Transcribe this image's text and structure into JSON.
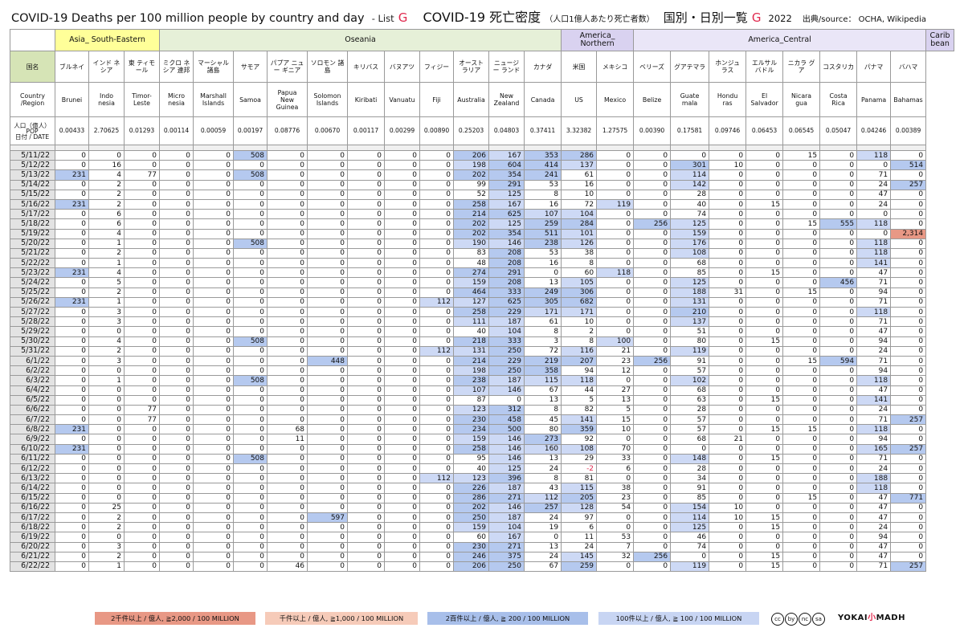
{
  "title": {
    "en": "COVID-19 Deaths per 100 million people by country and day",
    "list": "- List",
    "list_letter": "G",
    "jp_main": "COVID-19 死亡密度",
    "jp_note": "（人口1億人あたり死亡者数）",
    "jp_sub": "国別・日別一覧",
    "jp_letter": "G",
    "year": "2022",
    "source": "出典/source： OCHA, Wikipedia"
  },
  "labels": {
    "jp_row": "国名",
    "en_row": "Country /Region",
    "pop_row_a": "人口（億人）",
    "pop_row_b": "POP",
    "pop_row_c": "日付 / DATE"
  },
  "regions": [
    {
      "name": "Asia_ South-Eastern",
      "span": 3,
      "color": "#ffff99"
    },
    {
      "name": "Oseania",
      "span": 11,
      "color": "#e6f0d8"
    },
    {
      "name": "America_ Northern",
      "span": 2,
      "color": "#d9d2f0"
    },
    {
      "name": "America_Central",
      "span": 8,
      "color": "#eae6f7"
    },
    {
      "name": "Carib bean",
      "span": 1,
      "color": "#d9d2f0"
    }
  ],
  "countries": [
    {
      "jp": "ブルネイ",
      "en": "Brunei",
      "pop": "0.00433"
    },
    {
      "jp": "インド ネシア",
      "en": "Indo nesia",
      "pop": "2.70625"
    },
    {
      "jp": "東 ティモール",
      "en": "Timor- Leste",
      "pop": "0.01293"
    },
    {
      "jp": "ミクロ ネシア 連邦",
      "en": "Micro nesia",
      "pop": "0.00114"
    },
    {
      "jp": "マーシャル 諸島",
      "en": "Marshall Islands",
      "pop": "0.00059"
    },
    {
      "jp": "サモア",
      "en": "Samoa",
      "pop": "0.00197"
    },
    {
      "jp": "パプア ニュー ギニア",
      "en": "Papua New Guinea",
      "pop": "0.08776"
    },
    {
      "jp": "ソロモン 諸島",
      "en": "Solomon Islands",
      "pop": "0.00670"
    },
    {
      "jp": "キリバス",
      "en": "Kiribati",
      "pop": "0.00117"
    },
    {
      "jp": "バヌアツ",
      "en": "Vanuatu",
      "pop": "0.00299"
    },
    {
      "jp": "フィジー",
      "en": "Fiji",
      "pop": "0.00890"
    },
    {
      "jp": "オースト ラリア",
      "en": "Australia",
      "pop": "0.25203"
    },
    {
      "jp": "ニュージー ランド",
      "en": "New Zealand",
      "pop": "0.04803"
    },
    {
      "jp": "カナダ",
      "en": "Canada",
      "pop": "0.37411"
    },
    {
      "jp": "米国",
      "en": "US",
      "pop": "3.32382"
    },
    {
      "jp": "メキシコ",
      "en": "Mexico",
      "pop": "1.27575"
    },
    {
      "jp": "ベリーズ",
      "en": "Belize",
      "pop": "0.00390"
    },
    {
      "jp": "グアテマラ",
      "en": "Guate mala",
      "pop": "0.17581"
    },
    {
      "jp": "ホンジュ ラス",
      "en": "Hondu ras",
      "pop": "0.09746"
    },
    {
      "jp": "エルサル バドル",
      "en": "El Salvador",
      "pop": "0.06453"
    },
    {
      "jp": "ニカラ グア",
      "en": "Nicara gua",
      "pop": "0.06545"
    },
    {
      "jp": "コスタリカ",
      "en": "Costa Rica",
      "pop": "0.05047"
    },
    {
      "jp": "パナマ",
      "en": "Panama",
      "pop": "0.04246"
    },
    {
      "jp": "バハマ",
      "en": "Bahamas",
      "pop": "0.00389"
    }
  ],
  "rows": [
    {
      "date": "5/11/22",
      "v": [
        0,
        0,
        0,
        0,
        0,
        508,
        0,
        0,
        0,
        0,
        0,
        206,
        167,
        353,
        286,
        0,
        0,
        0,
        0,
        0,
        15,
        0,
        118,
        0
      ]
    },
    {
      "date": "5/12/22",
      "v": [
        0,
        16,
        0,
        0,
        0,
        0,
        0,
        0,
        0,
        0,
        0,
        198,
        604,
        414,
        137,
        0,
        0,
        301,
        10,
        0,
        0,
        0,
        0,
        514
      ]
    },
    {
      "date": "5/13/22",
      "v": [
        231,
        4,
        77,
        0,
        0,
        508,
        0,
        0,
        0,
        0,
        0,
        202,
        354,
        241,
        61,
        0,
        0,
        114,
        0,
        0,
        0,
        0,
        71,
        0
      ]
    },
    {
      "date": "5/14/22",
      "v": [
        0,
        2,
        0,
        0,
        0,
        0,
        0,
        0,
        0,
        0,
        0,
        99,
        291,
        53,
        16,
        0,
        0,
        142,
        0,
        0,
        0,
        0,
        24,
        257
      ]
    },
    {
      "date": "5/15/22",
      "v": [
        0,
        2,
        0,
        0,
        0,
        0,
        0,
        0,
        0,
        0,
        0,
        52,
        125,
        8,
        10,
        0,
        0,
        28,
        0,
        0,
        0,
        0,
        47,
        0
      ]
    },
    {
      "date": "5/16/22",
      "v": [
        231,
        2,
        0,
        0,
        0,
        0,
        0,
        0,
        0,
        0,
        0,
        258,
        167,
        16,
        72,
        119,
        0,
        40,
        0,
        15,
        0,
        0,
        24,
        0
      ]
    },
    {
      "date": "5/17/22",
      "v": [
        0,
        6,
        0,
        0,
        0,
        0,
        0,
        0,
        0,
        0,
        0,
        214,
        625,
        107,
        104,
        0,
        0,
        74,
        0,
        0,
        0,
        0,
        0,
        0
      ]
    },
    {
      "date": "5/18/22",
      "v": [
        0,
        6,
        0,
        0,
        0,
        0,
        0,
        0,
        0,
        0,
        0,
        202,
        125,
        259,
        284,
        0,
        256,
        125,
        0,
        0,
        15,
        555,
        118,
        0
      ]
    },
    {
      "date": "5/19/22",
      "v": [
        0,
        4,
        0,
        0,
        0,
        0,
        0,
        0,
        0,
        0,
        0,
        202,
        354,
        511,
        101,
        0,
        0,
        159,
        0,
        0,
        0,
        0,
        0,
        "2,314"
      ]
    },
    {
      "date": "5/20/22",
      "v": [
        0,
        1,
        0,
        0,
        0,
        508,
        0,
        0,
        0,
        0,
        0,
        190,
        146,
        238,
        126,
        0,
        0,
        176,
        0,
        0,
        0,
        0,
        118,
        0
      ]
    },
    {
      "date": "5/21/22",
      "v": [
        0,
        2,
        0,
        0,
        0,
        0,
        0,
        0,
        0,
        0,
        0,
        83,
        208,
        53,
        38,
        0,
        0,
        108,
        0,
        0,
        0,
        0,
        118,
        0
      ]
    },
    {
      "date": "5/22/22",
      "v": [
        0,
        1,
        0,
        0,
        0,
        0,
        0,
        0,
        0,
        0,
        0,
        48,
        208,
        16,
        8,
        0,
        0,
        68,
        0,
        0,
        0,
        0,
        141,
        0
      ]
    },
    {
      "date": "5/23/22",
      "v": [
        231,
        4,
        0,
        0,
        0,
        0,
        0,
        0,
        0,
        0,
        0,
        274,
        291,
        0,
        60,
        118,
        0,
        85,
        0,
        15,
        0,
        0,
        47,
        0
      ]
    },
    {
      "date": "5/24/22",
      "v": [
        0,
        5,
        0,
        0,
        0,
        0,
        0,
        0,
        0,
        0,
        0,
        159,
        208,
        13,
        105,
        0,
        0,
        125,
        0,
        0,
        0,
        456,
        71,
        0
      ]
    },
    {
      "date": "5/25/22",
      "v": [
        0,
        2,
        0,
        0,
        0,
        0,
        0,
        0,
        0,
        0,
        0,
        464,
        333,
        249,
        306,
        0,
        0,
        188,
        31,
        0,
        15,
        0,
        94,
        0
      ]
    },
    {
      "date": "5/26/22",
      "v": [
        231,
        1,
        0,
        0,
        0,
        0,
        0,
        0,
        0,
        0,
        112,
        127,
        625,
        305,
        682,
        0,
        0,
        131,
        0,
        0,
        0,
        0,
        71,
        0
      ]
    },
    {
      "date": "5/27/22",
      "v": [
        0,
        3,
        0,
        0,
        0,
        0,
        0,
        0,
        0,
        0,
        0,
        258,
        229,
        171,
        171,
        0,
        0,
        210,
        0,
        0,
        0,
        0,
        118,
        0
      ]
    },
    {
      "date": "5/28/22",
      "v": [
        0,
        3,
        0,
        0,
        0,
        0,
        0,
        0,
        0,
        0,
        0,
        111,
        187,
        61,
        10,
        0,
        0,
        137,
        0,
        0,
        0,
        0,
        71,
        0
      ]
    },
    {
      "date": "5/29/22",
      "v": [
        0,
        0,
        0,
        0,
        0,
        0,
        0,
        0,
        0,
        0,
        0,
        40,
        104,
        8,
        2,
        0,
        0,
        51,
        0,
        0,
        0,
        0,
        47,
        0
      ]
    },
    {
      "date": "5/30/22",
      "v": [
        0,
        4,
        0,
        0,
        0,
        508,
        0,
        0,
        0,
        0,
        0,
        218,
        333,
        3,
        8,
        100,
        0,
        80,
        0,
        15,
        0,
        0,
        94,
        0
      ]
    },
    {
      "date": "5/31/22",
      "v": [
        0,
        2,
        0,
        0,
        0,
        0,
        0,
        0,
        0,
        0,
        112,
        131,
        250,
        72,
        116,
        21,
        0,
        119,
        0,
        0,
        0,
        0,
        24,
        0
      ]
    },
    {
      "date": "6/1/22",
      "v": [
        0,
        3,
        0,
        0,
        0,
        0,
        0,
        448,
        0,
        0,
        0,
        214,
        229,
        219,
        207,
        23,
        256,
        91,
        0,
        0,
        15,
        594,
        71,
        0
      ]
    },
    {
      "date": "6/2/22",
      "v": [
        0,
        0,
        0,
        0,
        0,
        0,
        0,
        0,
        0,
        0,
        0,
        198,
        250,
        358,
        94,
        12,
        0,
        57,
        0,
        0,
        0,
        0,
        94,
        0
      ]
    },
    {
      "date": "6/3/22",
      "v": [
        0,
        1,
        0,
        0,
        0,
        508,
        0,
        0,
        0,
        0,
        0,
        238,
        187,
        115,
        118,
        0,
        0,
        102,
        0,
        0,
        0,
        0,
        118,
        0
      ]
    },
    {
      "date": "6/4/22",
      "v": [
        0,
        0,
        0,
        0,
        0,
        0,
        0,
        0,
        0,
        0,
        0,
        107,
        146,
        67,
        44,
        27,
        0,
        68,
        0,
        0,
        0,
        0,
        47,
        0
      ]
    },
    {
      "date": "6/5/22",
      "v": [
        0,
        0,
        0,
        0,
        0,
        0,
        0,
        0,
        0,
        0,
        0,
        87,
        0,
        13,
        5,
        13,
        0,
        63,
        0,
        15,
        0,
        0,
        141,
        0
      ]
    },
    {
      "date": "6/6/22",
      "v": [
        0,
        0,
        77,
        0,
        0,
        0,
        0,
        0,
        0,
        0,
        0,
        123,
        312,
        8,
        82,
        5,
        0,
        28,
        0,
        0,
        0,
        0,
        24,
        0
      ]
    },
    {
      "date": "6/7/22",
      "v": [
        0,
        0,
        77,
        0,
        0,
        0,
        0,
        0,
        0,
        0,
        0,
        230,
        458,
        45,
        141,
        15,
        0,
        57,
        0,
        0,
        0,
        0,
        71,
        257
      ]
    },
    {
      "date": "6/8/22",
      "v": [
        231,
        0,
        0,
        0,
        0,
        0,
        68,
        0,
        0,
        0,
        0,
        234,
        500,
        80,
        359,
        10,
        0,
        57,
        0,
        15,
        15,
        0,
        118,
        0
      ]
    },
    {
      "date": "6/9/22",
      "v": [
        0,
        0,
        0,
        0,
        0,
        0,
        11,
        0,
        0,
        0,
        0,
        159,
        146,
        273,
        92,
        0,
        0,
        68,
        21,
        0,
        0,
        0,
        94,
        0
      ]
    },
    {
      "date": "6/10/22",
      "v": [
        231,
        0,
        0,
        0,
        0,
        0,
        0,
        0,
        0,
        0,
        0,
        258,
        146,
        160,
        108,
        70,
        0,
        0,
        0,
        0,
        0,
        0,
        165,
        257
      ]
    },
    {
      "date": "6/11/22",
      "v": [
        0,
        0,
        0,
        0,
        0,
        508,
        0,
        0,
        0,
        0,
        0,
        95,
        146,
        13,
        29,
        33,
        0,
        148,
        0,
        15,
        0,
        0,
        71,
        0
      ]
    },
    {
      "date": "6/12/22",
      "v": [
        0,
        0,
        0,
        0,
        0,
        0,
        0,
        0,
        0,
        0,
        0,
        40,
        125,
        24,
        -2,
        6,
        0,
        28,
        0,
        0,
        0,
        0,
        24,
        0
      ]
    },
    {
      "date": "6/13/22",
      "v": [
        0,
        0,
        0,
        0,
        0,
        0,
        0,
        0,
        0,
        0,
        112,
        123,
        396,
        8,
        81,
        0,
        0,
        34,
        0,
        0,
        0,
        0,
        188,
        0
      ]
    },
    {
      "date": "6/14/22",
      "v": [
        0,
        0,
        0,
        0,
        0,
        0,
        0,
        0,
        0,
        0,
        0,
        226,
        187,
        43,
        115,
        38,
        0,
        91,
        0,
        0,
        0,
        0,
        118,
        0
      ]
    },
    {
      "date": "6/15/22",
      "v": [
        0,
        0,
        0,
        0,
        0,
        0,
        0,
        0,
        0,
        0,
        0,
        286,
        271,
        112,
        205,
        23,
        0,
        85,
        0,
        0,
        15,
        0,
        47,
        771
      ]
    },
    {
      "date": "6/16/22",
      "v": [
        0,
        25,
        0,
        0,
        0,
        0,
        0,
        0,
        0,
        0,
        0,
        202,
        146,
        257,
        128,
        54,
        0,
        154,
        10,
        0,
        0,
        0,
        47,
        0
      ]
    },
    {
      "date": "6/17/22",
      "v": [
        0,
        2,
        0,
        0,
        0,
        0,
        0,
        597,
        0,
        0,
        0,
        250,
        187,
        24,
        97,
        0,
        0,
        114,
        10,
        15,
        0,
        0,
        47,
        0
      ]
    },
    {
      "date": "6/18/22",
      "v": [
        0,
        2,
        0,
        0,
        0,
        0,
        0,
        0,
        0,
        0,
        0,
        159,
        104,
        19,
        6,
        0,
        0,
        125,
        0,
        15,
        0,
        0,
        24,
        0
      ]
    },
    {
      "date": "6/19/22",
      "v": [
        0,
        0,
        0,
        0,
        0,
        0,
        0,
        0,
        0,
        0,
        0,
        60,
        167,
        0,
        11,
        53,
        0,
        46,
        0,
        0,
        0,
        0,
        94,
        0
      ]
    },
    {
      "date": "6/20/22",
      "v": [
        0,
        3,
        0,
        0,
        0,
        0,
        0,
        0,
        0,
        0,
        0,
        230,
        271,
        13,
        24,
        7,
        0,
        74,
        0,
        0,
        0,
        0,
        47,
        0
      ]
    },
    {
      "date": "6/21/22",
      "v": [
        0,
        2,
        0,
        0,
        0,
        0,
        0,
        0,
        0,
        0,
        0,
        246,
        375,
        24,
        145,
        32,
        256,
        0,
        0,
        15,
        0,
        0,
        47,
        0
      ]
    },
    {
      "date": "6/22/22",
      "v": [
        0,
        1,
        0,
        0,
        0,
        0,
        46,
        0,
        0,
        0,
        0,
        206,
        250,
        67,
        259,
        0,
        0,
        119,
        0,
        15,
        0,
        0,
        71,
        257
      ]
    }
  ],
  "legend": [
    "2千件以上 / 億人, ≧2,000 / 100 MILLION",
    "千件以上 / 億人, ≧1,000 / 100 MILLION",
    "2百件以上 / 億人, ≧ 200 / 100 MILLION",
    "100件以上 / 億人, ≧ 100 / 100 MILLION"
  ],
  "legend_colors": [
    "#e89885",
    "#f6cbb9",
    "#a8bfea",
    "#c8d5f3"
  ],
  "cc_icons": [
    "cc",
    "by",
    "nc",
    "sa"
  ],
  "brand": {
    "a": "YOKAI",
    "b": "小",
    "c": "MADH"
  }
}
